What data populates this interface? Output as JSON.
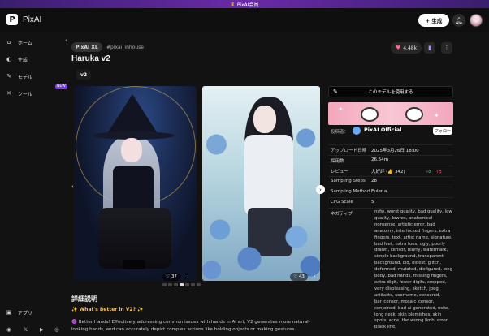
{
  "banner": {
    "text": "PixAI会員"
  },
  "header": {
    "logo_letter": "P",
    "logo_text": "PixAI",
    "create_label": "+ 生成"
  },
  "sidebar": {
    "items": [
      {
        "icon": "home-icon",
        "glyph": "⌂",
        "label": "ホーム"
      },
      {
        "icon": "palette-icon",
        "glyph": "◐",
        "label": "生成"
      },
      {
        "icon": "model-icon",
        "glyph": "✎",
        "label": "モデル"
      },
      {
        "icon": "tools-icon",
        "glyph": "✕",
        "label": "ツール"
      }
    ],
    "new_badge": "NEW",
    "app_label": "アプリ",
    "social": [
      "discord-icon",
      "x-icon",
      "youtube-icon",
      "instagram-icon"
    ]
  },
  "model": {
    "tag_primary": "PixAI XL",
    "tag_secondary": "#pixai_inhouse",
    "title": "Haruka v2",
    "version": "v2",
    "likes": "4.48k"
  },
  "gallery": {
    "images": [
      {
        "likes": "37"
      },
      {
        "likes": "43"
      }
    ],
    "dots": 7,
    "active_dot": 3
  },
  "description": {
    "heading": "詳細説明",
    "subheading": "✨ What's Better in V2? ✨",
    "text": "🟣 Better Hands! Effectively addressing common issues with hands in AI art, V2 generates more natural-looking hands, and can accurately depict complex actions like holding objects or making gestures."
  },
  "panel": {
    "use_button": "このモデルを使用する",
    "creator_label": "投稿者：",
    "creator_name": "PixAI Official",
    "follow_label": "フォロー",
    "rows": [
      {
        "k": "アップロード日時",
        "v": "2025年3月26日 18:00"
      },
      {
        "k": "採用数",
        "v": "26.54m"
      },
      {
        "k": "レビュー",
        "v": "大好評 (👍 342)"
      },
      {
        "k": "Sampling Steps",
        "v": "28"
      },
      {
        "k": "Sampling Method",
        "v": "Euler a"
      },
      {
        "k": "CFG Scale",
        "v": "5"
      },
      {
        "k": "ネガティブ",
        "v": ""
      }
    ],
    "negative_prompt": "nsfw, worst quality, bad quality, low quality, lowres, anatomical nonsense, artistic error, bad anatomy, interlocked fingers, extra fingers, text, artist name, signature, bad feet, extra toes, ugly, poorly drawn, censor, blurry, watermark, simple background, transparent background, old, oldest, glitch, deformed, mutated, disfigured, long body, bad hands, missing fingers, extra digit, fewer digits, cropped, very displeasing, sketch, jpeg artifacts, username, censored, bar_censor, mosaic_censor, conjoined, bad ai-generated, nsfw, long neck, skin blemishes, skin spots, acne, the wrong limb, error, black line,"
  },
  "colors": {
    "accent": "#7b3fe4",
    "like": "#ff6b8a",
    "positive": "#6fdc8c",
    "banner": "#6a2aa8"
  }
}
